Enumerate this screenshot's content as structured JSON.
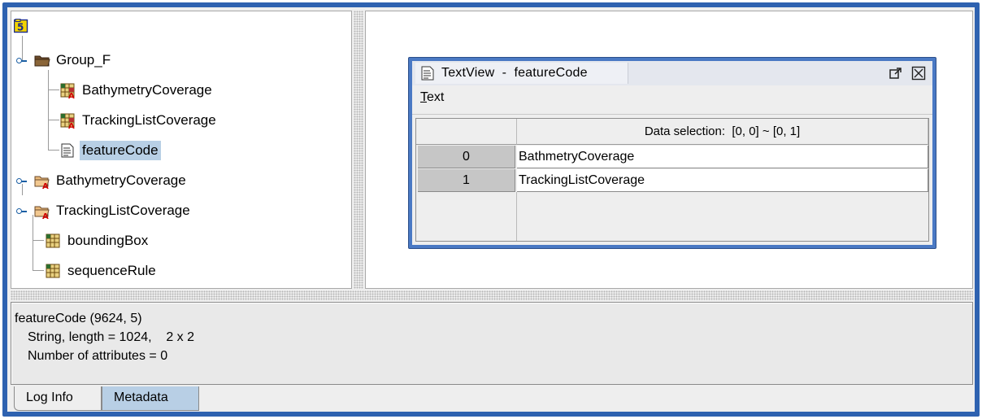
{
  "tree": {
    "root_icon": "hdf5-file-icon",
    "nodes": [
      {
        "label": "Group_F",
        "icon": "folder-open-icon",
        "depth": 0,
        "toggle": true
      },
      {
        "label": "BathymetryCoverage",
        "icon": "table-attr-icon",
        "depth": 1
      },
      {
        "label": "TrackingListCoverage",
        "icon": "table-attr-icon",
        "depth": 1
      },
      {
        "label": "featureCode",
        "icon": "text-dataset-icon",
        "depth": 1,
        "selected": true
      },
      {
        "label": "BathymetryCoverage",
        "icon": "folder-attr-icon",
        "depth": 0,
        "toggle": true
      },
      {
        "label": "TrackingListCoverage",
        "icon": "folder-attr-icon",
        "depth": 0,
        "toggle": true
      },
      {
        "label": "boundingBox",
        "icon": "table-icon",
        "depth": 0
      },
      {
        "label": "sequenceRule",
        "icon": "table-icon",
        "depth": 0
      }
    ]
  },
  "textview": {
    "title": "TextView  -  featureCode",
    "menu_text": "Text",
    "menu_mnemonic": "T",
    "menu_rest": "ext",
    "column_header": "Data selection:  [0, 0] ~ [0, 1]",
    "rows": [
      {
        "index": "0",
        "value": "BathmetryCoverage"
      },
      {
        "index": "1",
        "value": "TrackingListCoverage"
      }
    ]
  },
  "info": {
    "line1": "featureCode (9624, 5)",
    "line2": "String, length = 1024,    2 x 2",
    "line3": "Number of attributes = 0"
  },
  "tabs": [
    "Log Info",
    "Metadata"
  ],
  "colors": {
    "frame": "#2e62b0",
    "selection": "#b8cfe5",
    "window_border": "#4a79c4"
  }
}
